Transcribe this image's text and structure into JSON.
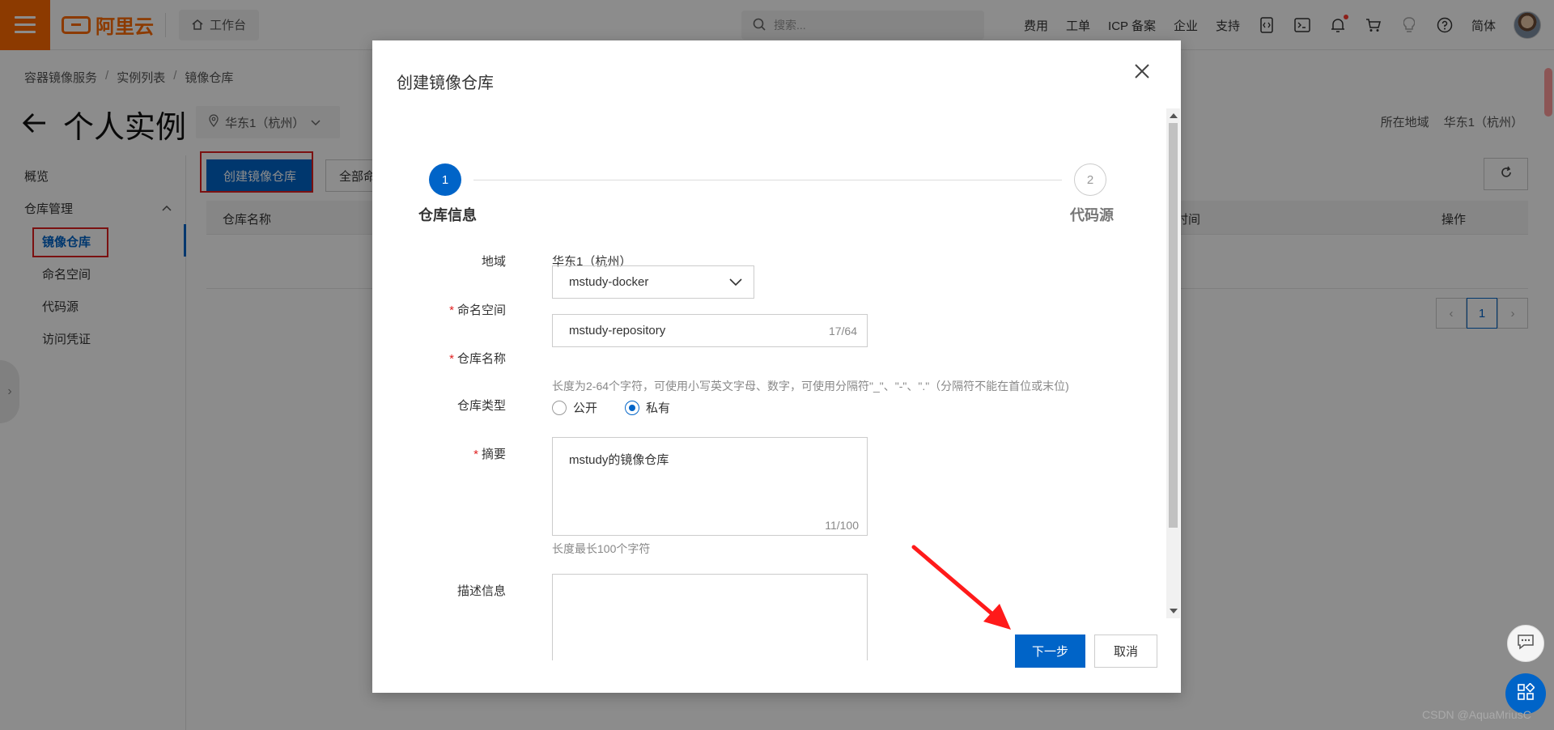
{
  "topbar": {
    "logo_text": "阿里云",
    "workbench": "工作台",
    "search_placeholder": "搜索...",
    "links": [
      "费用",
      "工单",
      "ICP 备案",
      "企业",
      "支持"
    ],
    "lang": "简体"
  },
  "breadcrumb": [
    "容器镜像服务",
    "实例列表",
    "镜像仓库"
  ],
  "page": {
    "title": "个人实例",
    "region_select": "华东1（杭州）",
    "region_label": "所在地域",
    "region_value": "华东1（杭州）"
  },
  "nav": {
    "overview": "概览",
    "repo_mgmt": "仓库管理",
    "items": [
      "镜像仓库",
      "命名空间",
      "代码源",
      "访问凭证"
    ]
  },
  "toolbar": {
    "create_label": "创建镜像仓库",
    "all_label": "全部命"
  },
  "table": {
    "headers": [
      "仓库名称",
      "时间",
      "操作"
    ],
    "current_page": "1"
  },
  "dialog": {
    "title": "创建镜像仓库",
    "steps": [
      {
        "num": "1",
        "label": "仓库信息"
      },
      {
        "num": "2",
        "label": "代码源"
      }
    ],
    "fields": {
      "region_label": "地域",
      "region_value": "华东1（杭州）",
      "namespace_label": "命名空间",
      "namespace_value": "mstudy-docker",
      "name_label": "仓库名称",
      "name_value": "mstudy-repository",
      "name_counter": "17/64",
      "name_help": "长度为2-64个字符，可使用小写英文字母、数字，可使用分隔符\"_\"、\"-\"、\".\"（分隔符不能在首位或末位)",
      "type_label": "仓库类型",
      "type_public": "公开",
      "type_private": "私有",
      "summary_label": "摘要",
      "summary_value": "mstudy的镜像仓库",
      "summary_counter": "11/100",
      "summary_help": "长度最长100个字符",
      "desc_label": "描述信息"
    },
    "next_label": "下一步",
    "cancel_label": "取消"
  },
  "watermark": "CSDN @AquaMriusC"
}
